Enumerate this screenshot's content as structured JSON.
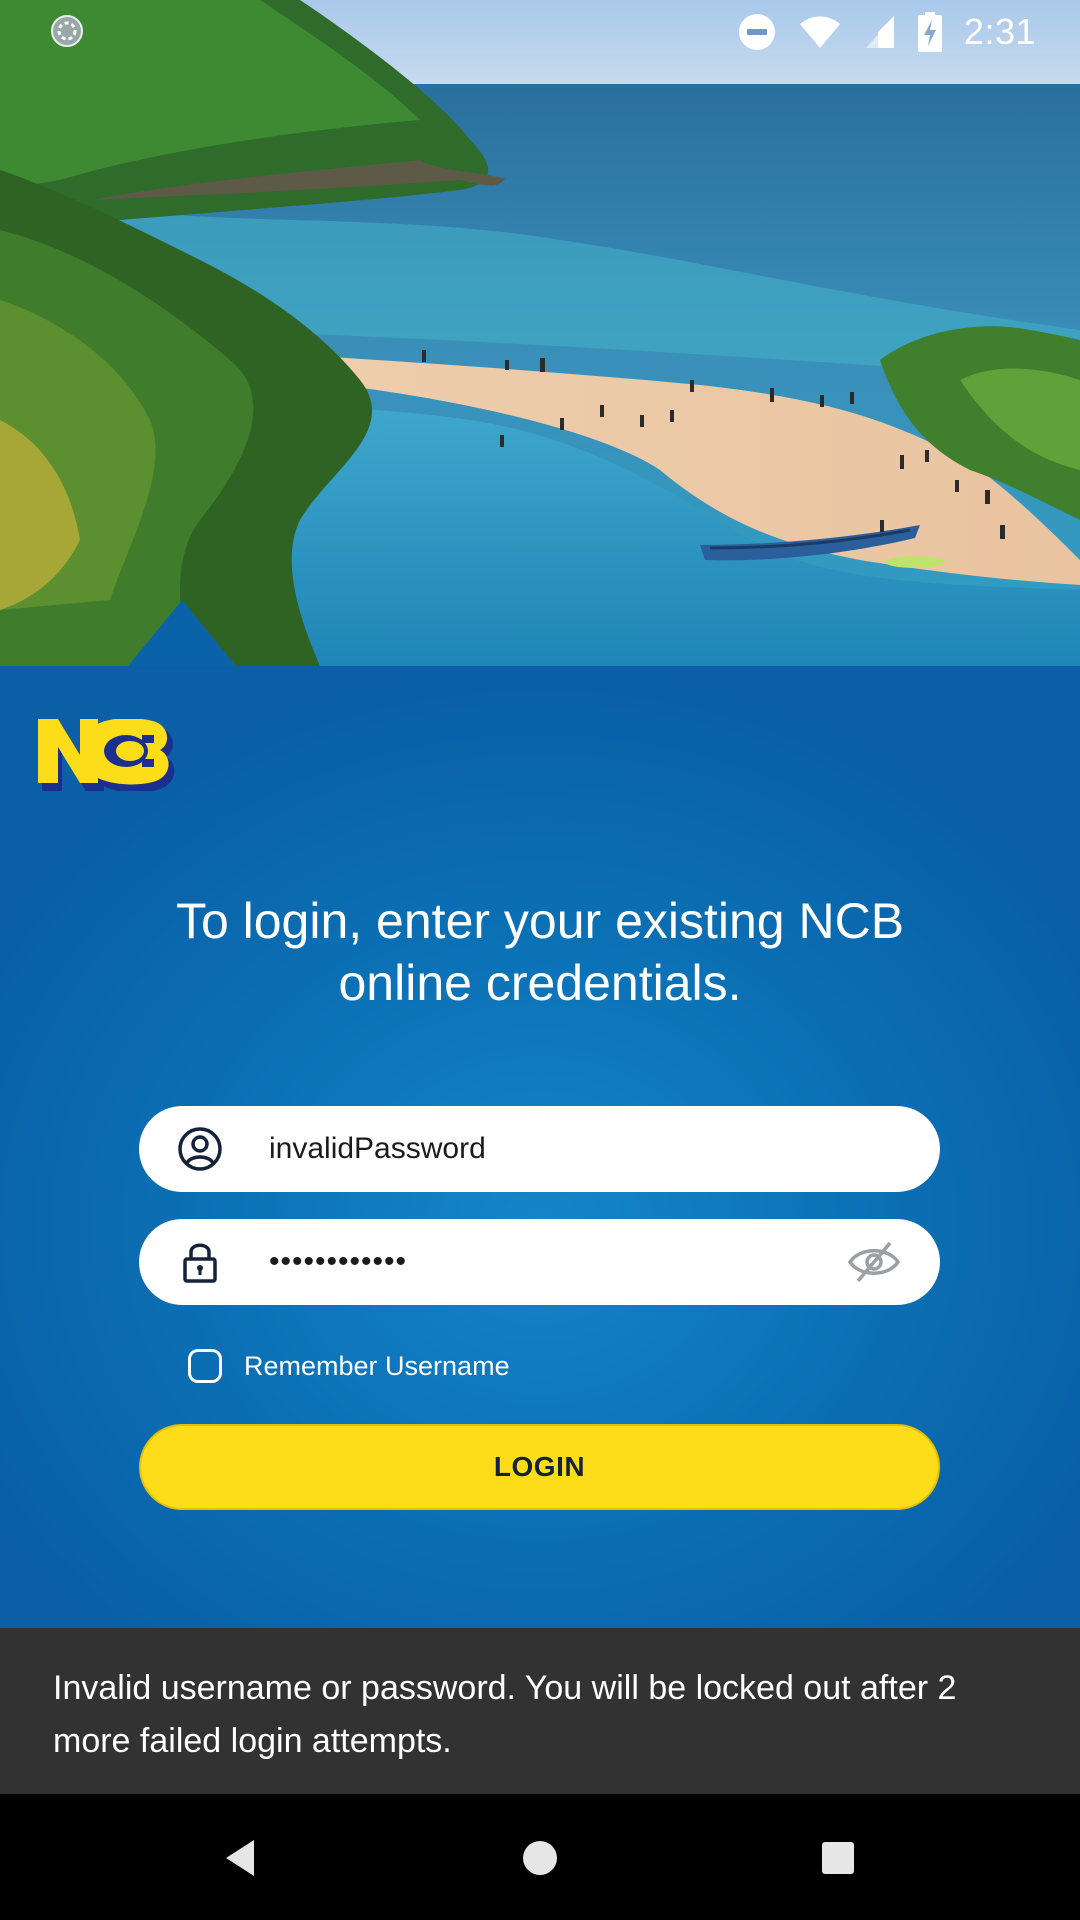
{
  "status_bar": {
    "time": "2:31",
    "icons": [
      "loading-circle-icon",
      "do-not-disturb-icon",
      "wifi-icon",
      "signal-icon",
      "battery-charging-icon"
    ]
  },
  "hero": {
    "description_icon": "beach-photo"
  },
  "brand": {
    "logo_text": "NCB",
    "logo_colors": {
      "primary": "#fddc1a",
      "secondary": "#1c2f8c"
    }
  },
  "login": {
    "heading": "To login, enter your existing NCB online credentials.",
    "username_value": "invalidPassword",
    "username_icon": "user-icon",
    "password_value": "••••••••••••",
    "password_icon": "lock-icon",
    "password_toggle_icon": "eye-off-icon",
    "remember_label": "Remember Username",
    "remember_checked": false,
    "login_label": "LOGIN"
  },
  "snackbar": {
    "message": "Invalid username or password. You will be locked out after 2 more failed login attempts."
  },
  "nav_bar": {
    "icons": [
      "back-icon",
      "home-icon",
      "recents-icon"
    ]
  },
  "colors": {
    "panel_blue": "#0b6fb4",
    "button_yellow": "#fddc1a",
    "snackbar_bg": "#323232"
  }
}
